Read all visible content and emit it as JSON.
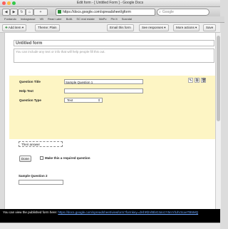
{
  "window": {
    "title": "Edit form - [ Untitled Form ] - Google Docs",
    "traffic_light_colors": [
      "#fc605b",
      "#fdbc40",
      "#34c84a"
    ]
  },
  "browser": {
    "back_icon": "back-arrow-icon",
    "forward_icon": "forward-arrow-icon",
    "reload_icon": "reload-icon",
    "home_icon": "home-icon",
    "add_bookmark_label": "+",
    "url": "https://docs.google.com/spreadsheet/gform",
    "search_placeholder": "Google",
    "bookmarks": [
      "Fontando",
      "Instagrasse",
      "VB",
      "Read Later",
      "BofA",
      "SC real estate",
      "WaPo",
      "Pin It",
      "Scandal"
    ]
  },
  "app_toolbar": {
    "add_item": "Add item",
    "theme": "Theme: Plain",
    "email_form": "Email this form",
    "see_responses": "See responses",
    "more_actions": "More actions",
    "save": "Save"
  },
  "form": {
    "title": "Untitled form",
    "description_placeholder": "You can include any text or info that will help people fill this out."
  },
  "question_editor": {
    "title_label": "Question Title",
    "title_value": "Sample Question 1",
    "help_label": "Help Text",
    "help_value": "",
    "type_label": "Question Type",
    "type_value": "Text",
    "preview_text": "Their answer",
    "done_label": "Done",
    "required_label": "Make this a required question",
    "required_checked": false,
    "panel_color": "#fdf5c4"
  },
  "question2": {
    "title": "Sample Question 2"
  },
  "notice": {
    "text": "You can view the published form here:",
    "link": "https://docs.google.com/spreadsheet/viewform?formkey=dHhRbVlBbG3aVzY5mYlUlV3cxeTB5MQ"
  }
}
